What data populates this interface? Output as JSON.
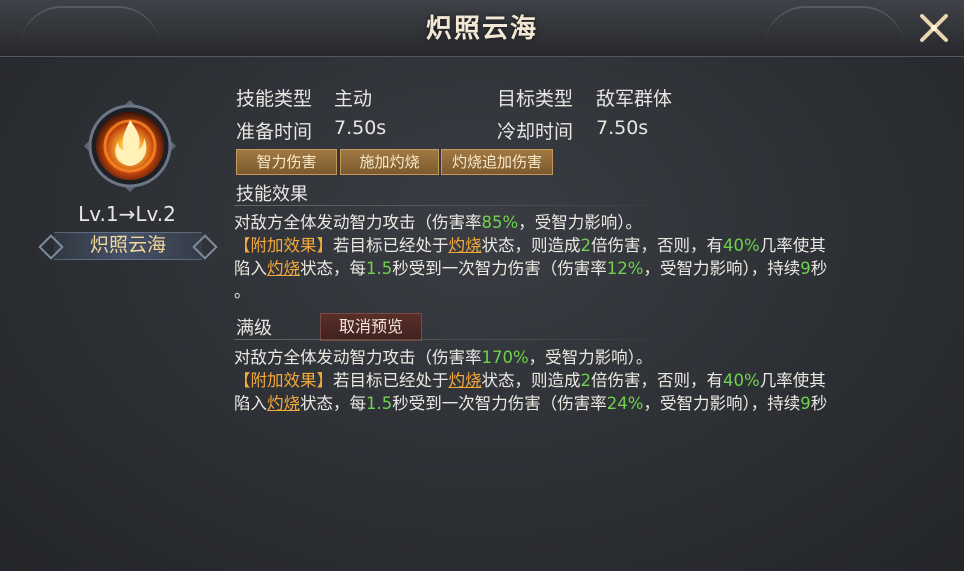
{
  "header": {
    "title": "炽照云海"
  },
  "skill": {
    "level_text": "Lv.1→Lv.2",
    "name": "炽照云海",
    "icon": "fire-icon"
  },
  "info": {
    "skill_type_label": "技能类型",
    "skill_type_value": "主动",
    "target_type_label": "目标类型",
    "target_type_value": "敌军群体",
    "prep_time_label": "准备时间",
    "prep_time_value": "7.50s",
    "cooldown_label": "冷却时间",
    "cooldown_value": "7.50s"
  },
  "tags": [
    "智力伤害",
    "施加灼烧",
    "灼烧追加伤害"
  ],
  "effect": {
    "title": "技能效果",
    "line1_a": "对敌方全体发动智力攻击（伤害率",
    "line1_rate": "85%",
    "line1_b": "，受智力影响）。",
    "bonus_tag": "【附加效果】",
    "line2_a": "若目标已经处于",
    "burn": "灼烧",
    "line2_b": "状态，则造成",
    "mult": "2",
    "line2_c": "倍伤害，否则，有",
    "chance": "40%",
    "line2_d": "几率使其",
    "line3_a": "陷入",
    "line3_b": "状态，每",
    "interval": "1.5",
    "line3_c": "秒受到一次智力伤害（伤害率",
    "dot_rate": "12%",
    "line3_d": "，受智力影响），持续",
    "duration": "9",
    "line3_e": "秒",
    "line4": "。"
  },
  "max": {
    "title": "满级",
    "cancel_preview": "取消预览",
    "line1_a": "对敌方全体发动智力攻击（伤害率",
    "line1_rate": "170%",
    "line1_b": "，受智力影响）。",
    "bonus_tag": "【附加效果】",
    "line2_a": "若目标已经处于",
    "burn": "灼烧",
    "line2_b": "状态，则造成",
    "mult": "2",
    "line2_c": "倍伤害，否则，有",
    "chance": "40%",
    "line2_d": "几率使其",
    "line3_a": "陷入",
    "line3_b": "状态，每",
    "interval": "1.5",
    "line3_c": "秒受到一次智力伤害（伤害率",
    "dot_rate": "24%",
    "line3_d": "，受智力影响），持续",
    "duration": "9",
    "line3_e": "秒"
  },
  "colors": {
    "highlight_green": "#6fd24e",
    "highlight_orange": "#f3a93a",
    "name_gold": "#f1d79a"
  }
}
